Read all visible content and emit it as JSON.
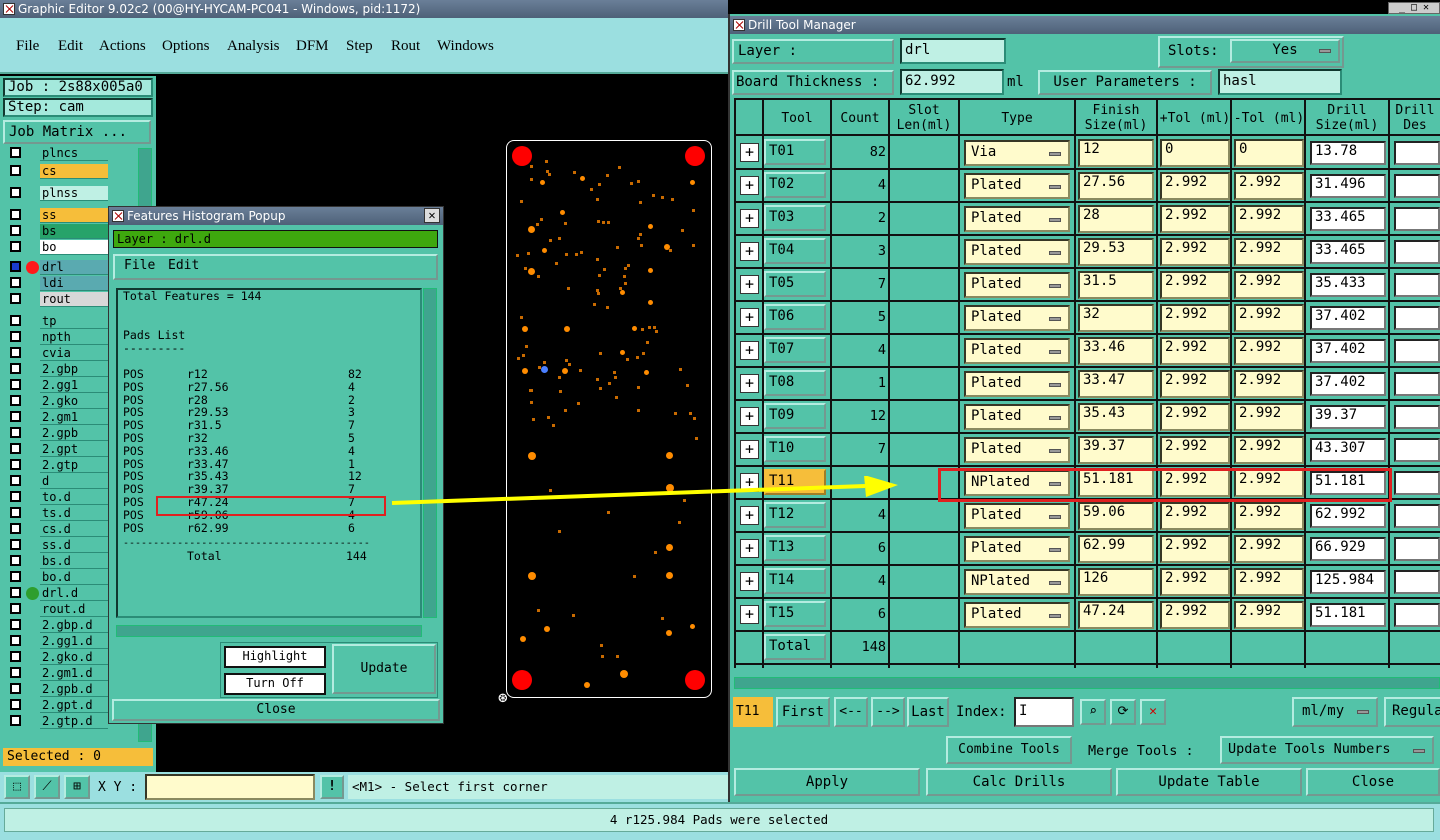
{
  "main_window": {
    "title": "Graphic Editor 9.02c2 (00@HY-HYCAM-PC041 - Windows, pid:1172)"
  },
  "menu": [
    "File",
    "Edit",
    "Actions",
    "Options",
    "Analysis",
    "DFM",
    "Step",
    "Rout",
    "Windows"
  ],
  "job": {
    "job_label": "Job : 2s88x005a0",
    "step_label": "Step: cam",
    "job_matrix": "Job Matrix ..."
  },
  "layers": [
    "plncs",
    "cs",
    "plnss",
    "ss",
    "bs",
    "bo",
    "drl",
    "ldi",
    "rout",
    "tp",
    "npth",
    "cvia",
    "2.gbp",
    "2.gg1",
    "2.gko",
    "2.gm1",
    "2.gpb",
    "2.gpt",
    "2.gtp",
    "d",
    "to.d",
    "ts.d",
    "cs.d",
    "ss.d",
    "bs.d",
    "bo.d",
    "drl.d",
    "rout.d",
    "2.gbp.d",
    "2.gg1.d",
    "2.gko.d",
    "2.gm1.d",
    "2.gpb.d",
    "2.gpt.d",
    "2.gtp.d"
  ],
  "selected": "Selected : 0",
  "xy": {
    "label": "X Y :",
    "prompt": "<M1> - Select first corner"
  },
  "histogram": {
    "title": "Features Histogram Popup",
    "layer": "Layer :  drl.d",
    "menu": [
      "File",
      "Edit"
    ],
    "total_features": "Total Features = 144",
    "pads_list": "Pads List",
    "underline": "---------",
    "rows": [
      [
        "POS",
        "r12",
        "82"
      ],
      [
        "POS",
        "r27.56",
        "4"
      ],
      [
        "POS",
        "r28",
        "2"
      ],
      [
        "POS",
        "r29.53",
        "3"
      ],
      [
        "POS",
        "r31.5",
        "7"
      ],
      [
        "POS",
        "r32",
        "5"
      ],
      [
        "POS",
        "r33.46",
        "4"
      ],
      [
        "POS",
        "r33.47",
        "1"
      ],
      [
        "POS",
        "r35.43",
        "12"
      ],
      [
        "POS",
        "r39.37",
        "7"
      ],
      [
        "POS",
        "r47.24",
        "7"
      ],
      [
        "POS",
        "r59.06",
        "4"
      ],
      [
        "POS",
        "r62.99",
        "6"
      ]
    ],
    "separator": "-----------------------------------------",
    "total": [
      "Total",
      "144"
    ],
    "buttons": {
      "highlight": "Highlight",
      "turn_off": "Turn Off",
      "update": "Update",
      "close": "Close"
    }
  },
  "dtm": {
    "title": "Drill Tool Manager",
    "layer_label": "Layer         :",
    "layer_value": "drl",
    "slots_label": "Slots:",
    "slots_value": "Yes",
    "thickness_label": "Board Thickness :",
    "thickness_value": "62.992",
    "thickness_unit": "ml",
    "user_params_label": "User Parameters :",
    "user_params_value": "hasl",
    "headers": [
      "Tool",
      "Count",
      "Slot Len(ml)",
      "Type",
      "Finish Size(ml)",
      "+Tol (ml)",
      "-Tol (ml)",
      "Drill Size(ml)",
      "Drill Des"
    ],
    "rows": [
      {
        "tool": "T01",
        "count": "82",
        "type": "Via",
        "finish": "12",
        "ptol": "0",
        "ntol": "0",
        "drill": "13.78"
      },
      {
        "tool": "T02",
        "count": "4",
        "type": "Plated",
        "finish": "27.56",
        "ptol": "2.992",
        "ntol": "2.992",
        "drill": "31.496"
      },
      {
        "tool": "T03",
        "count": "2",
        "type": "Plated",
        "finish": "28",
        "ptol": "2.992",
        "ntol": "2.992",
        "drill": "33.465"
      },
      {
        "tool": "T04",
        "count": "3",
        "type": "Plated",
        "finish": "29.53",
        "ptol": "2.992",
        "ntol": "2.992",
        "drill": "33.465"
      },
      {
        "tool": "T05",
        "count": "7",
        "type": "Plated",
        "finish": "31.5",
        "ptol": "2.992",
        "ntol": "2.992",
        "drill": "35.433"
      },
      {
        "tool": "T06",
        "count": "5",
        "type": "Plated",
        "finish": "32",
        "ptol": "2.992",
        "ntol": "2.992",
        "drill": "37.402"
      },
      {
        "tool": "T07",
        "count": "4",
        "type": "Plated",
        "finish": "33.46",
        "ptol": "2.992",
        "ntol": "2.992",
        "drill": "37.402"
      },
      {
        "tool": "T08",
        "count": "1",
        "type": "Plated",
        "finish": "33.47",
        "ptol": "2.992",
        "ntol": "2.992",
        "drill": "37.402"
      },
      {
        "tool": "T09",
        "count": "12",
        "type": "Plated",
        "finish": "35.43",
        "ptol": "2.992",
        "ntol": "2.992",
        "drill": "39.37"
      },
      {
        "tool": "T10",
        "count": "7",
        "type": "Plated",
        "finish": "39.37",
        "ptol": "2.992",
        "ntol": "2.992",
        "drill": "43.307"
      },
      {
        "tool": "T11",
        "count": "",
        "type": "NPlated",
        "finish": "51.181",
        "ptol": "2.992",
        "ntol": "2.992",
        "drill": "51.181"
      },
      {
        "tool": "T12",
        "count": "4",
        "type": "Plated",
        "finish": "59.06",
        "ptol": "2.992",
        "ntol": "2.992",
        "drill": "62.992"
      },
      {
        "tool": "T13",
        "count": "6",
        "type": "Plated",
        "finish": "62.99",
        "ptol": "2.992",
        "ntol": "2.992",
        "drill": "66.929"
      },
      {
        "tool": "T14",
        "count": "4",
        "type": "NPlated",
        "finish": "126",
        "ptol": "2.992",
        "ntol": "2.992",
        "drill": "125.984"
      },
      {
        "tool": "T15",
        "count": "6",
        "type": "Plated",
        "finish": "47.24",
        "ptol": "2.992",
        "ntol": "2.992",
        "drill": "51.181"
      }
    ],
    "total_label": "Total",
    "total_count": "148",
    "nav": {
      "current": "T11",
      "first": "First",
      "prev": "<--",
      "next": "-->",
      "last": "Last",
      "index": "Index:",
      "units": "ml/my",
      "regular": "Regula"
    },
    "actions": {
      "combine": "Combine Tools",
      "merge": "Merge Tools :",
      "update_numbers": "Update Tools Numbers"
    },
    "bottom": {
      "apply": "Apply",
      "calc": "Calc Drills",
      "update_table": "Update Table",
      "close": "Close"
    }
  },
  "status": "4 r125.984 Pads were selected",
  "colors": {
    "teal": "#53c3a8",
    "yellow": "#fffbcc",
    "highlight_red": "#e02020",
    "arrow": "#ffff00"
  }
}
